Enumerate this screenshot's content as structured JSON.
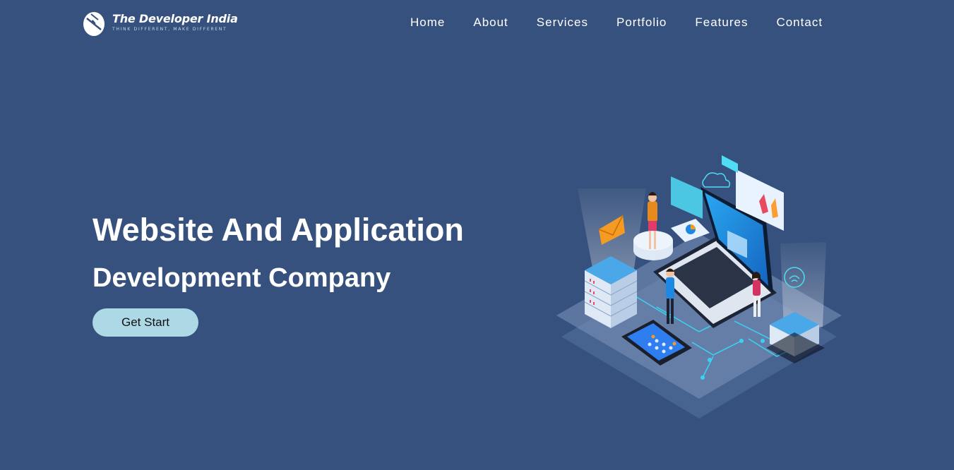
{
  "brand": {
    "name": "The Developer India",
    "tagline": "THINK DIFFERENT, MAKE DIFFERENT",
    "logo_icon": "mouse-logo-icon"
  },
  "nav": {
    "items": [
      {
        "label": "Home"
      },
      {
        "label": "About"
      },
      {
        "label": "Services"
      },
      {
        "label": "Portfolio"
      },
      {
        "label": "Features"
      },
      {
        "label": "Contact"
      }
    ]
  },
  "hero": {
    "title_line_1": "Website And Application",
    "title_line_2": "Development Company",
    "cta_label": "Get Start",
    "illustration_icon": "isometric-development-illustration"
  },
  "colors": {
    "background": "#36517d",
    "cta_background": "#add8e6",
    "text": "#ffffff"
  }
}
